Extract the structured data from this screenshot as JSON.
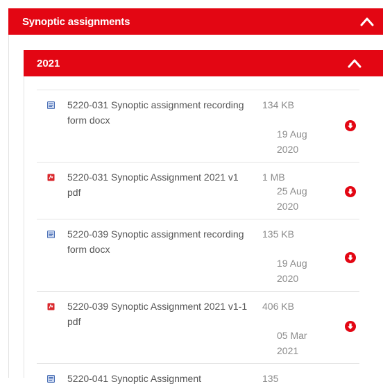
{
  "section": {
    "title": "Synoptic assignments",
    "toggle_icon": "chevron-up-icon"
  },
  "year_group": {
    "title": "2021",
    "toggle_icon": "chevron-up-icon"
  },
  "files": [
    {
      "name": "5220-031 Synoptic assignment recording form docx",
      "type": "docx",
      "size": "134 KB",
      "date": "19 Aug 2020"
    },
    {
      "name": "5220-031 Synoptic Assignment 2021 v1 pdf",
      "type": "pdf",
      "size": "1 MB",
      "date": "25 Aug 2020"
    },
    {
      "name": "5220-039 Synoptic assignment recording form docx",
      "type": "docx",
      "size": "135 KB",
      "date": "19 Aug 2020"
    },
    {
      "name": "5220-039 Synoptic Assignment 2021 v1-1 pdf",
      "type": "pdf",
      "size": "406 KB",
      "date": "05 Mar 2021"
    },
    {
      "name": "5220-041 Synoptic Assignment",
      "type": "docx",
      "size": "135",
      "date": ""
    }
  ],
  "colors": {
    "brand_red": "#e30613",
    "docx_icon": "#4a6fb5",
    "pdf_icon": "#d9262b"
  },
  "icons": {
    "download": "download-circle-icon",
    "docx": "word-document-icon",
    "pdf": "pdf-document-icon"
  }
}
